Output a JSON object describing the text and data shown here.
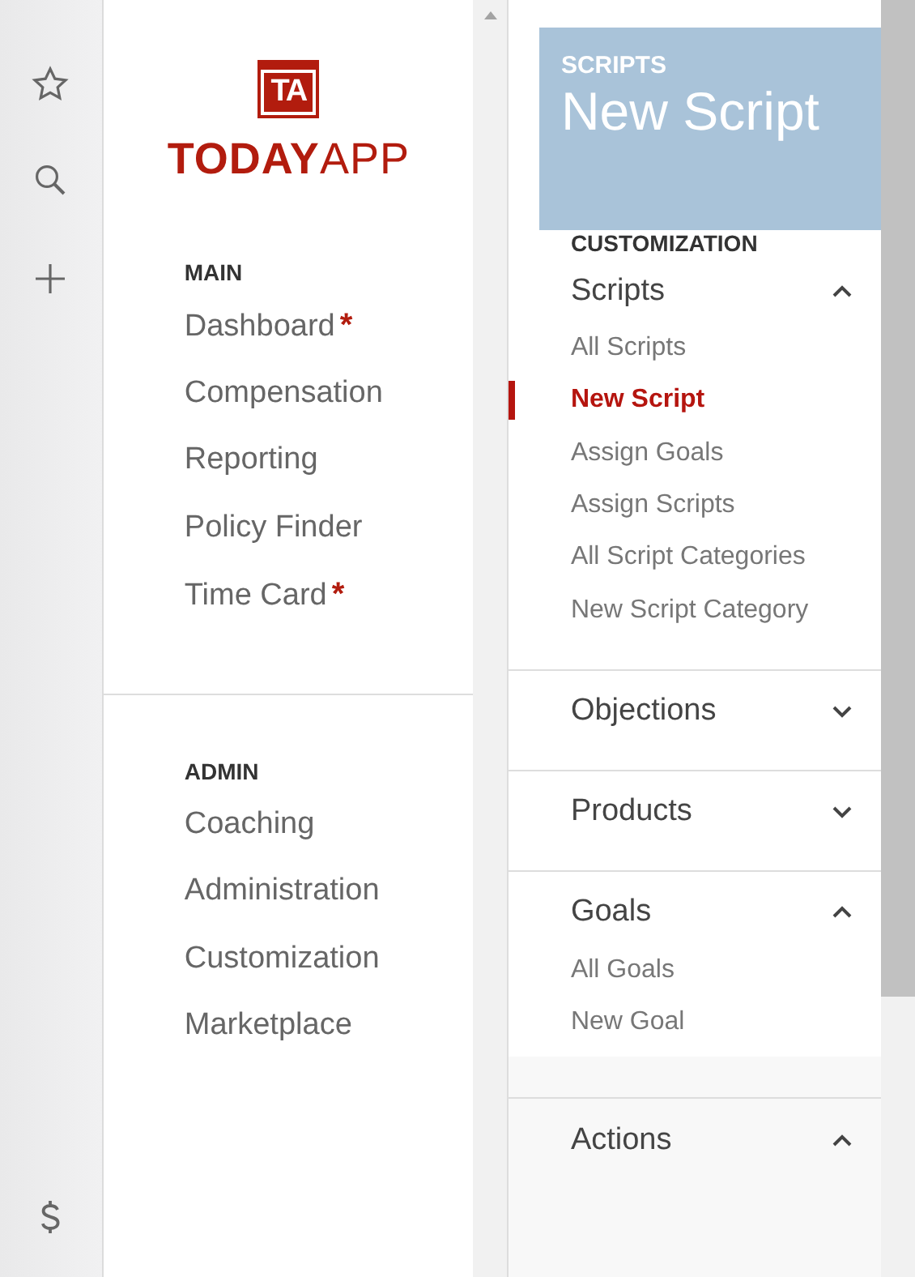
{
  "logo": {
    "badge": "TA",
    "wordmark": "**TODAY**APP"
  },
  "nav": {
    "sections": [
      {
        "heading": "MAIN",
        "items": [
          {
            "label": "Dashboard",
            "marker": "*"
          },
          {
            "label": "Compensation"
          },
          {
            "label": "Reporting"
          },
          {
            "label": "Policy Finder"
          },
          {
            "label": "Time Card",
            "marker": "*"
          }
        ]
      },
      {
        "heading": "ADMIN",
        "items": [
          {
            "label": "Coaching"
          },
          {
            "label": "Administration"
          },
          {
            "label": "Customization"
          },
          {
            "label": "Marketplace"
          }
        ]
      }
    ]
  },
  "background_page": {
    "eyebrow": "SCRIPTS",
    "title": "New Script"
  },
  "submenu": {
    "heading": "CUSTOMIZATION",
    "groups": [
      {
        "label": "Scripts",
        "expanded": true,
        "children": [
          {
            "label": "All Scripts",
            "selected": false
          },
          {
            "label": "New Script",
            "selected": true
          },
          {
            "label": "Assign Goals",
            "selected": false
          },
          {
            "label": "Assign Scripts",
            "selected": false
          },
          {
            "label": "All Script Categories",
            "selected": false
          },
          {
            "label": "New Script Category",
            "selected": false
          }
        ]
      },
      {
        "label": "Objections",
        "expanded": false
      },
      {
        "label": "Products",
        "expanded": false
      },
      {
        "label": "Goals",
        "expanded": true,
        "children": [
          {
            "label": "All Goals",
            "selected": false
          },
          {
            "label": "New Goal",
            "selected": false
          }
        ]
      },
      {
        "label": "Actions",
        "expanded": true
      }
    ]
  }
}
